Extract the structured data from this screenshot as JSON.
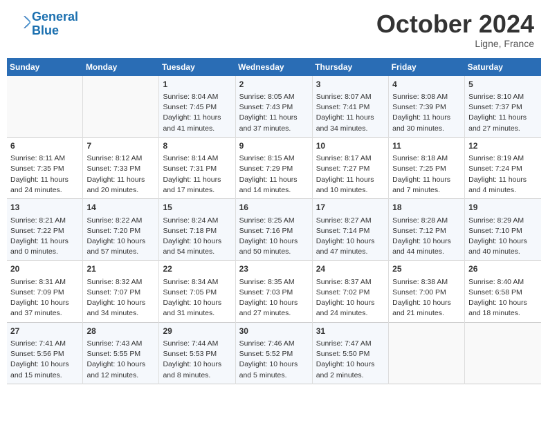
{
  "header": {
    "logo_line1": "General",
    "logo_line2": "Blue",
    "month": "October 2024",
    "location": "Ligne, France"
  },
  "weekdays": [
    "Sunday",
    "Monday",
    "Tuesday",
    "Wednesday",
    "Thursday",
    "Friday",
    "Saturday"
  ],
  "weeks": [
    [
      {
        "day": "",
        "info": ""
      },
      {
        "day": "",
        "info": ""
      },
      {
        "day": "1",
        "info": "Sunrise: 8:04 AM\nSunset: 7:45 PM\nDaylight: 11 hours and 41 minutes."
      },
      {
        "day": "2",
        "info": "Sunrise: 8:05 AM\nSunset: 7:43 PM\nDaylight: 11 hours and 37 minutes."
      },
      {
        "day": "3",
        "info": "Sunrise: 8:07 AM\nSunset: 7:41 PM\nDaylight: 11 hours and 34 minutes."
      },
      {
        "day": "4",
        "info": "Sunrise: 8:08 AM\nSunset: 7:39 PM\nDaylight: 11 hours and 30 minutes."
      },
      {
        "day": "5",
        "info": "Sunrise: 8:10 AM\nSunset: 7:37 PM\nDaylight: 11 hours and 27 minutes."
      }
    ],
    [
      {
        "day": "6",
        "info": "Sunrise: 8:11 AM\nSunset: 7:35 PM\nDaylight: 11 hours and 24 minutes."
      },
      {
        "day": "7",
        "info": "Sunrise: 8:12 AM\nSunset: 7:33 PM\nDaylight: 11 hours and 20 minutes."
      },
      {
        "day": "8",
        "info": "Sunrise: 8:14 AM\nSunset: 7:31 PM\nDaylight: 11 hours and 17 minutes."
      },
      {
        "day": "9",
        "info": "Sunrise: 8:15 AM\nSunset: 7:29 PM\nDaylight: 11 hours and 14 minutes."
      },
      {
        "day": "10",
        "info": "Sunrise: 8:17 AM\nSunset: 7:27 PM\nDaylight: 11 hours and 10 minutes."
      },
      {
        "day": "11",
        "info": "Sunrise: 8:18 AM\nSunset: 7:25 PM\nDaylight: 11 hours and 7 minutes."
      },
      {
        "day": "12",
        "info": "Sunrise: 8:19 AM\nSunset: 7:24 PM\nDaylight: 11 hours and 4 minutes."
      }
    ],
    [
      {
        "day": "13",
        "info": "Sunrise: 8:21 AM\nSunset: 7:22 PM\nDaylight: 11 hours and 0 minutes."
      },
      {
        "day": "14",
        "info": "Sunrise: 8:22 AM\nSunset: 7:20 PM\nDaylight: 10 hours and 57 minutes."
      },
      {
        "day": "15",
        "info": "Sunrise: 8:24 AM\nSunset: 7:18 PM\nDaylight: 10 hours and 54 minutes."
      },
      {
        "day": "16",
        "info": "Sunrise: 8:25 AM\nSunset: 7:16 PM\nDaylight: 10 hours and 50 minutes."
      },
      {
        "day": "17",
        "info": "Sunrise: 8:27 AM\nSunset: 7:14 PM\nDaylight: 10 hours and 47 minutes."
      },
      {
        "day": "18",
        "info": "Sunrise: 8:28 AM\nSunset: 7:12 PM\nDaylight: 10 hours and 44 minutes."
      },
      {
        "day": "19",
        "info": "Sunrise: 8:29 AM\nSunset: 7:10 PM\nDaylight: 10 hours and 40 minutes."
      }
    ],
    [
      {
        "day": "20",
        "info": "Sunrise: 8:31 AM\nSunset: 7:09 PM\nDaylight: 10 hours and 37 minutes."
      },
      {
        "day": "21",
        "info": "Sunrise: 8:32 AM\nSunset: 7:07 PM\nDaylight: 10 hours and 34 minutes."
      },
      {
        "day": "22",
        "info": "Sunrise: 8:34 AM\nSunset: 7:05 PM\nDaylight: 10 hours and 31 minutes."
      },
      {
        "day": "23",
        "info": "Sunrise: 8:35 AM\nSunset: 7:03 PM\nDaylight: 10 hours and 27 minutes."
      },
      {
        "day": "24",
        "info": "Sunrise: 8:37 AM\nSunset: 7:02 PM\nDaylight: 10 hours and 24 minutes."
      },
      {
        "day": "25",
        "info": "Sunrise: 8:38 AM\nSunset: 7:00 PM\nDaylight: 10 hours and 21 minutes."
      },
      {
        "day": "26",
        "info": "Sunrise: 8:40 AM\nSunset: 6:58 PM\nDaylight: 10 hours and 18 minutes."
      }
    ],
    [
      {
        "day": "27",
        "info": "Sunrise: 7:41 AM\nSunset: 5:56 PM\nDaylight: 10 hours and 15 minutes."
      },
      {
        "day": "28",
        "info": "Sunrise: 7:43 AM\nSunset: 5:55 PM\nDaylight: 10 hours and 12 minutes."
      },
      {
        "day": "29",
        "info": "Sunrise: 7:44 AM\nSunset: 5:53 PM\nDaylight: 10 hours and 8 minutes."
      },
      {
        "day": "30",
        "info": "Sunrise: 7:46 AM\nSunset: 5:52 PM\nDaylight: 10 hours and 5 minutes."
      },
      {
        "day": "31",
        "info": "Sunrise: 7:47 AM\nSunset: 5:50 PM\nDaylight: 10 hours and 2 minutes."
      },
      {
        "day": "",
        "info": ""
      },
      {
        "day": "",
        "info": ""
      }
    ]
  ]
}
